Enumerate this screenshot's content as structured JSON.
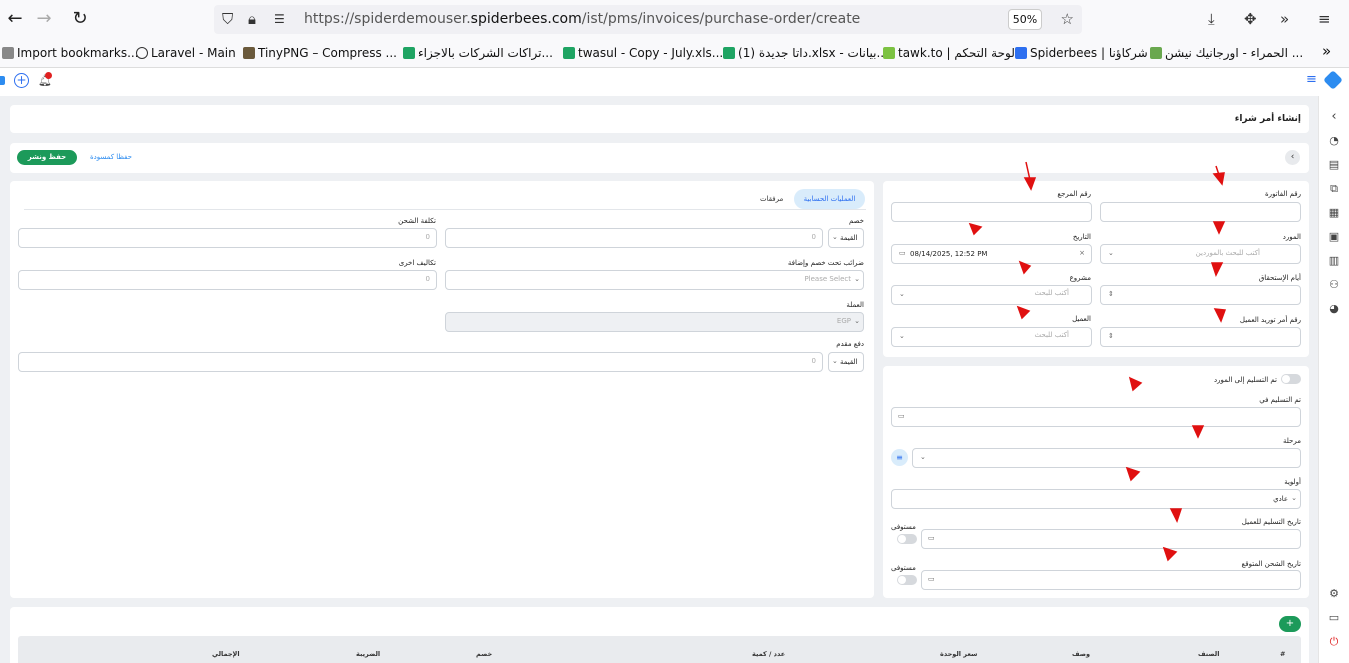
{
  "browser": {
    "url_prefix": "https://spiderdemouser.",
    "url_domain": "spiderbees.com",
    "url_path": "/ist/pms/invoices/purchase-order/create",
    "zoom": "50%",
    "bookmarks": [
      "Import bookmarks...",
      "Laravel - Main",
      "TinyPNG – Compress ...",
      "تراكات الشركات بالاجزاء...",
      "twasul - Copy - July.xls...",
      "داتا جديدة (1).xlsx - بيانات...",
      "tawk.to | لوحة التحكم",
      "Spiderbees | شركاؤنا",
      "الحمراء - اورجانيك نيشن ..."
    ]
  },
  "page": {
    "title": "إنشاء أمر شراء",
    "save_publish": "حفظ ونشر",
    "save_draft": "حفظا كمسودة"
  },
  "form": {
    "invoice_number": "رقم الفاتورة",
    "reference_number": "رقم المرجع",
    "supplier": "المورد",
    "supplier_placeholder": "أكتب للبحث بالموردين",
    "date": "التاريخ",
    "date_value": "08/14/2025, 12:52 PM",
    "due_days": "أيام الإستحقاق",
    "project": "مشروع",
    "search_placeholder": "أكتب للبحث",
    "client_supply_order": "رقم أمر توريد العميل",
    "client": "العميل"
  },
  "delivery": {
    "delivered_to_supplier": "تم التسليم إلى المورد",
    "delivered_on": "تم التسليم في",
    "stage": "مرحلة",
    "priority": "أولوية",
    "priority_value": "عادي",
    "client_delivery_date": "تاريخ التسليم للعميل",
    "expected_shipping_date": "تاريخ الشحن المتوقع",
    "fulfilled": "مستوفى"
  },
  "tabs": {
    "accounting": "العمليات الحسابية",
    "attachments": "مرفقات"
  },
  "accounting": {
    "discount": "خصم",
    "value_option": "القيمة",
    "shipping_cost": "تكلفة الشحن",
    "taxes": "ضرائب تحت خصم وإضافة",
    "taxes_placeholder": "Please Select",
    "other_costs": "تكاليف اخرى",
    "currency": "العملة",
    "currency_value": "EGP",
    "advance_payment": "دفع مقدم",
    "zero": "0"
  },
  "table": {
    "headers": [
      "#",
      "الصنف",
      "وصف",
      "سعر الوحدة",
      "عدد / كمية",
      "خصم",
      "الضريبة",
      "الإجمالي"
    ],
    "add_icon": "+"
  },
  "colors": {
    "accent_green": "#1c9a5a",
    "tab_blue": "#d9ecfb",
    "red_annotation": "#e01010"
  }
}
